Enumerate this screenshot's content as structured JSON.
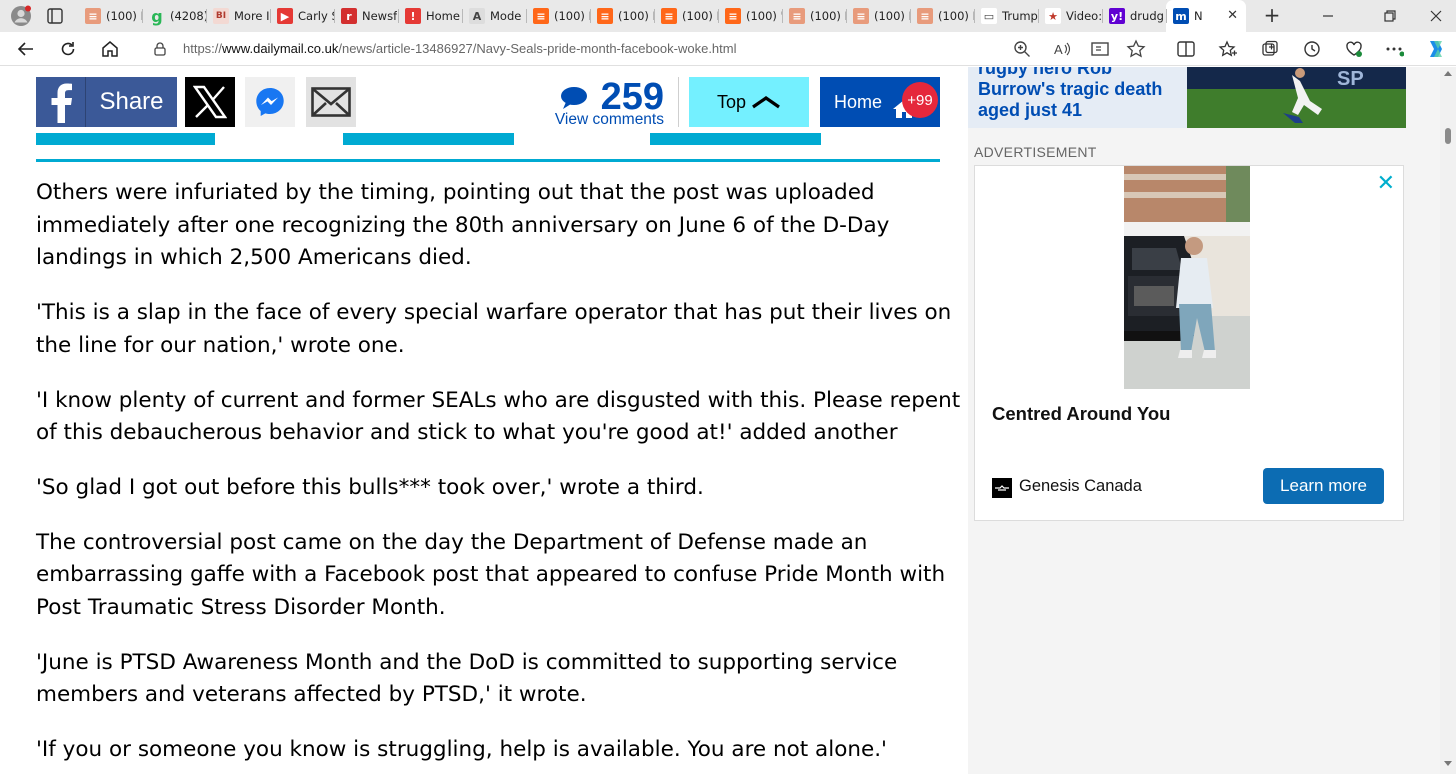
{
  "browser": {
    "tabs": [
      {
        "label": "(100) I",
        "favicon": "substack-icon",
        "color": "#e89b7c"
      },
      {
        "label": "(4208)",
        "favicon": "g-icon",
        "color": "#2ab757"
      },
      {
        "label": "More I",
        "favicon": "bi-icon",
        "color": "#f3d9d3"
      },
      {
        "label": "Carly S",
        "favicon": "youtube-icon",
        "color": "#e53935"
      },
      {
        "label": "Newsf",
        "favicon": "r-icon",
        "color": "#d32f2f"
      },
      {
        "label": "Home",
        "favicon": "home-red-icon",
        "color": "#e53935"
      },
      {
        "label": "Mode",
        "favicon": "ai-icon",
        "color": "#dddddd"
      },
      {
        "label": "(100) E",
        "favicon": "substack-icon",
        "color": "#ff6719"
      },
      {
        "label": "(100) I",
        "favicon": "substack-icon",
        "color": "#ff6719"
      },
      {
        "label": "(100) I",
        "favicon": "substack-icon",
        "color": "#ff6719"
      },
      {
        "label": "(100) '",
        "favicon": "substack-icon",
        "color": "#ff6719"
      },
      {
        "label": "(100) I",
        "favicon": "substack-icon",
        "color": "#e89b7c"
      },
      {
        "label": "(100) I",
        "favicon": "substack-icon",
        "color": "#e89b7c"
      },
      {
        "label": "(100) I",
        "favicon": "substack-icon",
        "color": "#e89b7c"
      },
      {
        "label": "Trump",
        "favicon": "page-icon",
        "color": "#ffffff"
      },
      {
        "label": "Video:",
        "favicon": "star-icon",
        "color": "#ffffff"
      },
      {
        "label": "drudg",
        "favicon": "yahoo-icon",
        "color": "#6001d2"
      },
      {
        "label": "N",
        "favicon": "dailymail-icon",
        "color": "#004db3"
      }
    ],
    "url": {
      "prefix": "https://",
      "host": "www.dailymail.co.uk",
      "path": "/news/article-13486927/Navy-Seals-pride-month-facebook-woke.html"
    }
  },
  "share": {
    "facebook_label": "Share",
    "comment_count": "259",
    "comments_label": "View comments",
    "top_label": "Top",
    "home_label": "Home",
    "home_badge": "+99"
  },
  "article": {
    "paragraphs": [
      [
        "Others were infuriated by the timing, pointing out that the post was uploaded",
        "immediately after one recognizing the 80th anniversary on June 6 of the D-Day",
        "landings in which 2,500 Americans died."
      ],
      [
        "'This is a slap in the face of every special warfare operator that has put their lives on",
        "the line for our nation,' wrote one."
      ],
      [
        "'I know plenty of current and former SEALs who are disgusted with this. Please repent",
        "of this debaucherous behavior and stick to what you're good at!' added another"
      ],
      [
        "'So glad I got out before this bulls*** took over,' wrote a third."
      ],
      [
        "The controversial post came on the day the Department of Defense made an",
        "embarrassing gaffe with a Facebook post that appeared to confuse Pride Month with",
        "Post Traumatic Stress Disorder Month."
      ],
      [
        "'June is PTSD Awareness Month and the DoD is committed to supporting service",
        "members and veterans affected by PTSD,' it wrote."
      ],
      [
        "'If you or someone you know is struggling, help is available. You are not alone.'"
      ]
    ]
  },
  "sidebar": {
    "puff_lines": [
      "rugby hero Rob",
      "Burrow's tragic death",
      "aged just 41"
    ],
    "advert_label": "ADVERTISEMENT",
    "ad": {
      "title": "Centred Around You",
      "advertiser": "Genesis Canada",
      "cta": "Learn more",
      "close": "✕"
    }
  },
  "colors": {
    "dailymail_blue": "#004db3",
    "facebook_blue": "#3b5998",
    "cyan_accent": "#00aad2",
    "top_button": "#74f0ff",
    "badge_red": "#e5283b",
    "ad_cta": "#0c6cb3"
  }
}
